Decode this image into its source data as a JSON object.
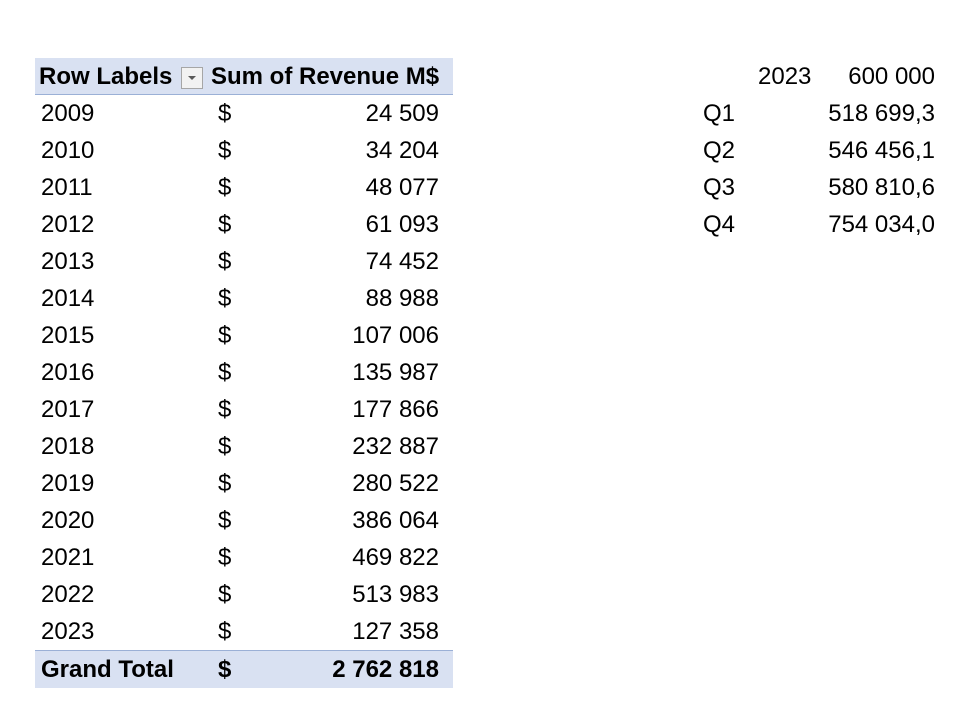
{
  "pivot": {
    "header": {
      "row_labels": "Row Labels",
      "sum_label": "Sum of Revenue M$",
      "filter_icon": "dropdown-arrow-icon"
    },
    "rows": [
      {
        "label": "2009",
        "currency": "$",
        "value": "24 509"
      },
      {
        "label": "2010",
        "currency": "$",
        "value": "34 204"
      },
      {
        "label": "2011",
        "currency": "$",
        "value": "48 077"
      },
      {
        "label": "2012",
        "currency": "$",
        "value": "61 093"
      },
      {
        "label": "2013",
        "currency": "$",
        "value": "74 452"
      },
      {
        "label": "2014",
        "currency": "$",
        "value": "88 988"
      },
      {
        "label": "2015",
        "currency": "$",
        "value": "107 006"
      },
      {
        "label": "2016",
        "currency": "$",
        "value": "135 987"
      },
      {
        "label": "2017",
        "currency": "$",
        "value": "177 866"
      },
      {
        "label": "2018",
        "currency": "$",
        "value": "232 887"
      },
      {
        "label": "2019",
        "currency": "$",
        "value": "280 522"
      },
      {
        "label": "2020",
        "currency": "$",
        "value": "386 064"
      },
      {
        "label": "2021",
        "currency": "$",
        "value": "469 822"
      },
      {
        "label": "2022",
        "currency": "$",
        "value": "513 983"
      },
      {
        "label": "2023",
        "currency": "$",
        "value": "127 358"
      }
    ],
    "total": {
      "label": "Grand Total",
      "currency": "$",
      "value": "2 762 818"
    },
    "colors": {
      "band": "#d9e1f2",
      "band_border": "#9bb0d6"
    }
  },
  "side": {
    "header": {
      "year": "2023",
      "value": "600 000"
    },
    "rows": [
      {
        "label": "Q1",
        "value": "518 699,3"
      },
      {
        "label": "Q2",
        "value": "546 456,1"
      },
      {
        "label": "Q3",
        "value": "580 810,6"
      },
      {
        "label": "Q4",
        "value": "754 034,0"
      }
    ]
  }
}
